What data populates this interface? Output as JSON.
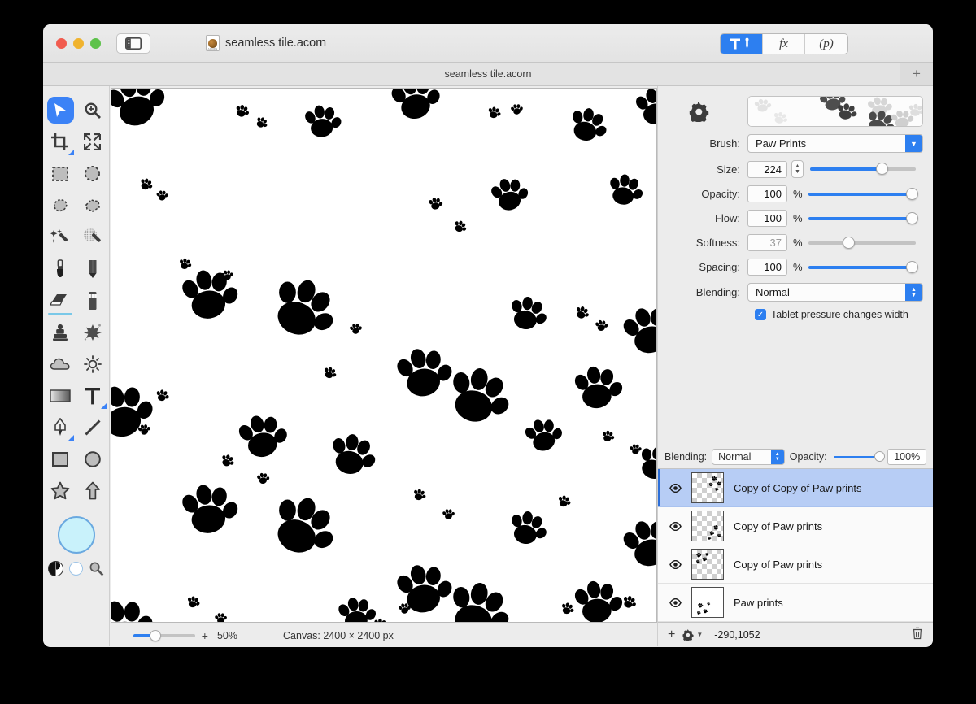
{
  "window": {
    "title": "seamless tile.acorn",
    "doc_icon": "acorn-document-icon",
    "sidebar_toggle_icon": "sidebar-toggle-icon",
    "traffic_lights": [
      "close",
      "minimize",
      "zoom"
    ],
    "toolbar_segments": [
      {
        "name": "tools-segment",
        "label": "",
        "icon": "hammer-pen-icon",
        "active": true
      },
      {
        "name": "effects-segment",
        "label": "fx",
        "icon": "fx-icon",
        "active": false
      },
      {
        "name": "palettes-segment",
        "label": "(p)",
        "icon": "palettes-icon",
        "active": false
      }
    ]
  },
  "tabbar": {
    "tab_title": "seamless tile.acorn",
    "add_label": "+"
  },
  "tools": {
    "items": [
      {
        "name": "move-tool",
        "icon": "cursor-arrow-icon",
        "selected": true
      },
      {
        "name": "zoom-tool",
        "icon": "magnifier-plus-icon",
        "selected": false
      },
      {
        "name": "crop-tool",
        "icon": "crop-icon",
        "selected": false,
        "badge": "corner"
      },
      {
        "name": "transform-tool",
        "icon": "arrows-expand-icon",
        "selected": false
      },
      {
        "name": "rectangle-select-tool",
        "icon": "marquee-rect-icon",
        "selected": false
      },
      {
        "name": "ellipse-select-tool",
        "icon": "marquee-ellipse-icon",
        "selected": false
      },
      {
        "name": "lasso-tool",
        "icon": "lasso-icon",
        "selected": false
      },
      {
        "name": "polygon-lasso-tool",
        "icon": "polygon-lasso-icon",
        "selected": false
      },
      {
        "name": "magic-wand-tool",
        "icon": "magic-wand-icon",
        "selected": false
      },
      {
        "name": "instant-alpha-tool",
        "icon": "magic-wand-dotted-icon",
        "selected": false
      },
      {
        "name": "brush-tool",
        "icon": "paint-brush-icon",
        "selected": false
      },
      {
        "name": "pencil-tool",
        "icon": "pencil-icon",
        "selected": false
      },
      {
        "name": "eraser-tool",
        "icon": "eraser-icon",
        "selected": false,
        "badge": "underline"
      },
      {
        "name": "marker-tool",
        "icon": "marker-icon",
        "selected": false
      },
      {
        "name": "clone-stamp-tool",
        "icon": "stamp-icon",
        "selected": false
      },
      {
        "name": "smudge-tool",
        "icon": "smudge-spark-icon",
        "selected": false
      },
      {
        "name": "blur-tool",
        "icon": "cloud-icon",
        "selected": false
      },
      {
        "name": "dodge-tool",
        "icon": "sun-icon",
        "selected": false
      },
      {
        "name": "gradient-tool",
        "icon": "gradient-icon",
        "selected": false
      },
      {
        "name": "text-tool",
        "icon": "text-t-icon",
        "selected": false,
        "badge": "corner"
      },
      {
        "name": "pen-tool",
        "icon": "bezier-pen-icon",
        "selected": false,
        "badge": "corner"
      },
      {
        "name": "line-tool",
        "icon": "line-icon",
        "selected": false
      },
      {
        "name": "rectangle-shape-tool",
        "icon": "square-shape-icon",
        "selected": false
      },
      {
        "name": "ellipse-shape-tool",
        "icon": "circle-shape-icon",
        "selected": false
      },
      {
        "name": "star-tool",
        "icon": "star-icon",
        "selected": false
      },
      {
        "name": "arrow-tool",
        "icon": "arrow-up-icon",
        "selected": false
      }
    ],
    "color_swatch": "#c9f2fb",
    "swatch_border": "#6aa9e0",
    "mini_icons": [
      "black-white-swatch-icon",
      "transparent-swatch-icon",
      "eyedropper-magnifier-icon"
    ]
  },
  "canvas": {
    "pattern_name": "paw-prints-pattern",
    "background": "#ffffff",
    "ink": "#000000"
  },
  "statusbar": {
    "zoom_minus": "–",
    "zoom_plus": "+",
    "zoom_value": "50%",
    "canvas_size": "Canvas: 2400 × 2400 px"
  },
  "brush_panel": {
    "gear_icon": "gear-icon",
    "preview_name": "brush-preview",
    "rows": [
      {
        "label": "Brush:",
        "type": "combo",
        "value": "Paw Prints"
      },
      {
        "label": "Size:",
        "type": "number",
        "value": "224",
        "unit": "",
        "fill": 68,
        "disabled": false
      },
      {
        "label": "Opacity:",
        "type": "number",
        "value": "100",
        "unit": "%",
        "fill": 100,
        "disabled": false
      },
      {
        "label": "Flow:",
        "type": "number",
        "value": "100",
        "unit": "%",
        "fill": 100,
        "disabled": false
      },
      {
        "label": "Softness:",
        "type": "number",
        "value": "37",
        "unit": "%",
        "fill": 37,
        "disabled": true
      },
      {
        "label": "Spacing:",
        "type": "number",
        "value": "100",
        "unit": "%",
        "fill": 100,
        "disabled": false
      },
      {
        "label": "Blending:",
        "type": "combo2",
        "value": "Normal"
      }
    ],
    "checkbox_label": "Tablet pressure changes width",
    "checkbox_checked": true,
    "accent": "#2d7ff0"
  },
  "layers_panel": {
    "header": {
      "blending_label": "Blending:",
      "blending_value": "Normal",
      "opacity_label": "Opacity:",
      "opacity_value": "100%"
    },
    "layers": [
      {
        "name": "Copy of Copy of Paw prints",
        "visible": true,
        "selected": true,
        "thumb": "checker-paws-top-right"
      },
      {
        "name": "Copy of Paw prints",
        "visible": true,
        "selected": false,
        "thumb": "checker-paws-bottom-right"
      },
      {
        "name": "Copy of Paw prints",
        "visible": true,
        "selected": false,
        "thumb": "checker-paws-top-left"
      },
      {
        "name": "Paw prints",
        "visible": true,
        "selected": false,
        "thumb": "white-paws-bottom-left"
      }
    ],
    "footer": {
      "add_label": "+",
      "gear_icon": "gear-dropdown-icon",
      "coordinates": "-290,1052",
      "trash_icon": "trash-icon"
    },
    "selection_color": "#b7cdf5"
  }
}
